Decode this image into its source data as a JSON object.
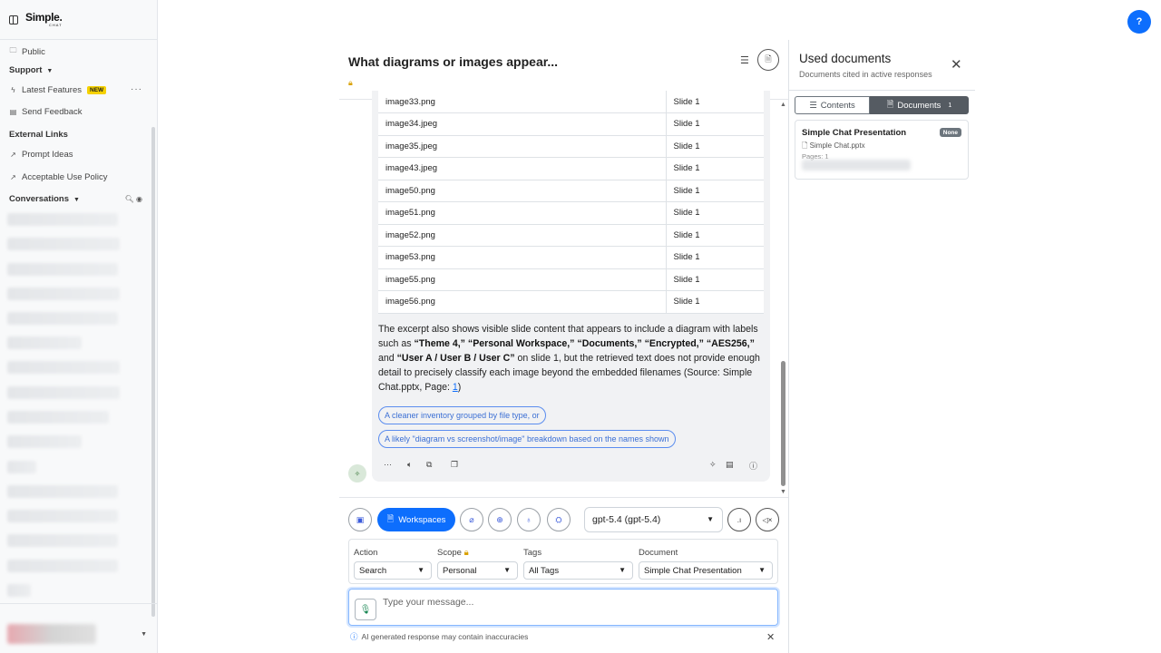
{
  "app": {
    "logo_line1": "Simple.",
    "logo_line2": "CHAT"
  },
  "sidebar": {
    "public_label": "Public",
    "support_label": "Support",
    "latest_features_label": "Latest Features",
    "new_badge": "NEW",
    "send_feedback_label": "Send Feedback",
    "external_links_label": "External Links",
    "prompt_ideas_label": "Prompt Ideas",
    "acceptable_use_label": "Acceptable Use Policy",
    "conversations_label": "Conversations"
  },
  "chat": {
    "title": "What diagrams or images appear...",
    "lock_icon": "lock-icon",
    "image_table": [
      {
        "name": "image33.png",
        "slide": "Slide 1"
      },
      {
        "name": "image34.jpeg",
        "slide": "Slide 1"
      },
      {
        "name": "image35.jpeg",
        "slide": "Slide 1"
      },
      {
        "name": "image43.jpeg",
        "slide": "Slide 1"
      },
      {
        "name": "image50.png",
        "slide": "Slide 1"
      },
      {
        "name": "image51.png",
        "slide": "Slide 1"
      },
      {
        "name": "image52.png",
        "slide": "Slide 1"
      },
      {
        "name": "image53.png",
        "slide": "Slide 1"
      },
      {
        "name": "image55.png",
        "slide": "Slide 1"
      },
      {
        "name": "image56.png",
        "slide": "Slide 1"
      }
    ],
    "message": {
      "t1": "The excerpt also shows visible slide content that appears to include a diagram with labels such as ",
      "b1": "“Theme 4,” “Personal Workspace,” “Documents,” “Encrypted,” “AES256,”",
      "t2": " and ",
      "b2": "“User A / User B / User C”",
      "t3": " on slide 1, but the retrieved text does not provide enough detail to precisely classify each image beyond the embedded filenames (Source: Simple Chat.pptx, Page: ",
      "link": "1",
      "t4": ")"
    },
    "suggestions": [
      "A cleaner inventory grouped by file type, or",
      "A likely \"diagram vs screenshot/image\" breakdown based on the names shown"
    ]
  },
  "toolbar": {
    "workspaces_label": "Workspaces",
    "model": "gpt-5.4 (gpt-5.4)"
  },
  "filters": {
    "action_label": "Action",
    "action_value": "Search",
    "scope_label": "Scope",
    "scope_value": "Personal",
    "tags_label": "Tags",
    "tags_value": "All Tags",
    "document_label": "Document",
    "document_value": "Simple Chat Presentation"
  },
  "input": {
    "placeholder": "Type your message...",
    "disclaimer": "AI generated response may contain inaccuracies"
  },
  "panel": {
    "title": "Used documents",
    "subtitle": "Documents cited in active responses",
    "tab_contents": "Contents",
    "tab_documents": "Documents",
    "documents_count": "1",
    "doc": {
      "title": "Simple Chat Presentation",
      "badge": "None",
      "file": "Simple Chat.pptx",
      "pages": "Pages: 1"
    }
  },
  "colors": {
    "primary": "#0d6efd",
    "badge_new": "#f5d100",
    "tab_active": "#555b62"
  }
}
